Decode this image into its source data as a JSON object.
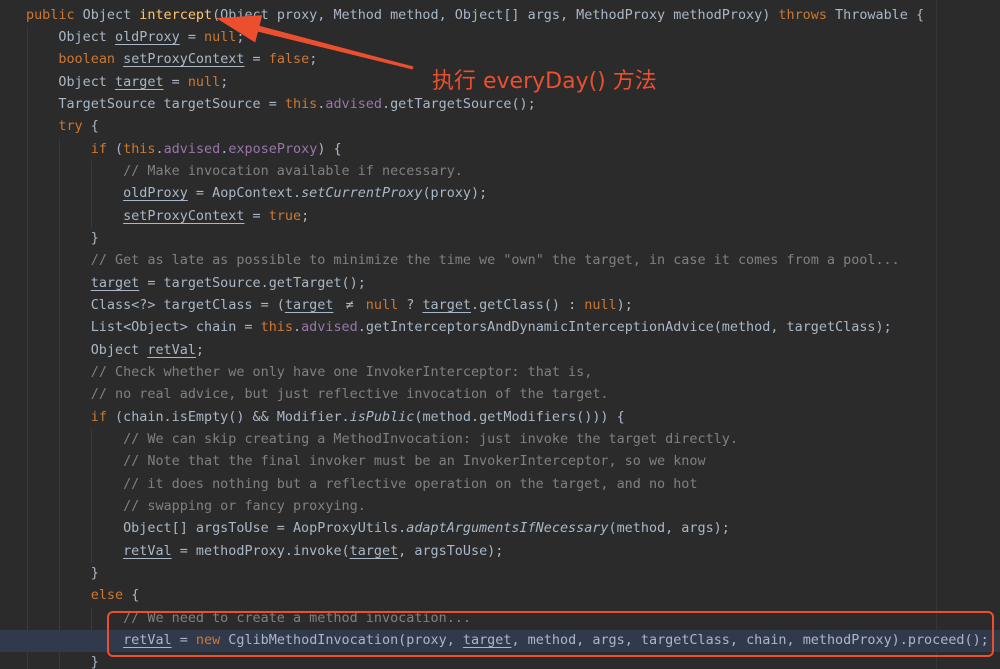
{
  "theme": {
    "background": "#2b2b2b",
    "text": "#a9b7c6",
    "keyword": "#cc7832",
    "method_declaration": "#ffc66d",
    "field": "#9876aa",
    "comment": "#808080",
    "caret_row": "#313a4b",
    "indent_guide": "#3a3a3a",
    "annotation": "#ec4f2e"
  },
  "editor": {
    "lines": [
      {
        "tokens": [
          {
            "t": "public",
            "k": "kw"
          },
          {
            "t": " Object "
          },
          {
            "t": "intercept",
            "k": "decl"
          },
          {
            "t": "(Object proxy, Method method, Object[] args, MethodProxy methodProxy) "
          },
          {
            "t": "throws",
            "k": "kw"
          },
          {
            "t": " Throwable {"
          }
        ]
      },
      {
        "tokens": [
          {
            "t": "    Object "
          },
          {
            "t": "oldProxy",
            "k": "var"
          },
          {
            "t": " = "
          },
          {
            "t": "null",
            "k": "kw"
          },
          {
            "t": ";"
          }
        ]
      },
      {
        "tokens": [
          {
            "t": "    "
          },
          {
            "t": "boolean",
            "k": "kw"
          },
          {
            "t": " "
          },
          {
            "t": "setProxyContext",
            "k": "var"
          },
          {
            "t": " = "
          },
          {
            "t": "false",
            "k": "kw"
          },
          {
            "t": ";"
          }
        ]
      },
      {
        "tokens": [
          {
            "t": "    Object "
          },
          {
            "t": "target",
            "k": "var"
          },
          {
            "t": " = "
          },
          {
            "t": "null",
            "k": "kw"
          },
          {
            "t": ";"
          }
        ]
      },
      {
        "tokens": [
          {
            "t": "    TargetSource targetSource = "
          },
          {
            "t": "this",
            "k": "kw"
          },
          {
            "t": "."
          },
          {
            "t": "advised",
            "k": "field"
          },
          {
            "t": ".getTargetSource();"
          }
        ]
      },
      {
        "tokens": [
          {
            "t": "    "
          },
          {
            "t": "try",
            "k": "kw"
          },
          {
            "t": " {"
          }
        ]
      },
      {
        "tokens": [
          {
            "t": "        "
          },
          {
            "t": "if",
            "k": "kw"
          },
          {
            "t": " ("
          },
          {
            "t": "this",
            "k": "kw"
          },
          {
            "t": "."
          },
          {
            "t": "advised",
            "k": "field"
          },
          {
            "t": "."
          },
          {
            "t": "exposeProxy",
            "k": "field"
          },
          {
            "t": ") {"
          }
        ]
      },
      {
        "tokens": [
          {
            "t": "            "
          },
          {
            "t": "// Make invocation available if necessary.",
            "k": "comment"
          }
        ]
      },
      {
        "tokens": [
          {
            "t": "            "
          },
          {
            "t": "oldProxy",
            "k": "var"
          },
          {
            "t": " = AopContext."
          },
          {
            "t": "setCurrentProxy",
            "k": "static"
          },
          {
            "t": "(proxy);"
          }
        ]
      },
      {
        "tokens": [
          {
            "t": "            "
          },
          {
            "t": "setProxyContext",
            "k": "var"
          },
          {
            "t": " = "
          },
          {
            "t": "true",
            "k": "kw"
          },
          {
            "t": ";"
          }
        ]
      },
      {
        "tokens": [
          {
            "t": "        }"
          }
        ]
      },
      {
        "tokens": [
          {
            "t": "        "
          },
          {
            "t": "// Get as late as possible to minimize the time we \"own\" the target, in case it comes from a pool...",
            "k": "comment"
          }
        ]
      },
      {
        "tokens": [
          {
            "t": "        "
          },
          {
            "t": "target",
            "k": "var"
          },
          {
            "t": " = targetSource.getTarget();"
          }
        ]
      },
      {
        "tokens": [
          {
            "t": "        Class<?> targetClass = ("
          },
          {
            "t": "target",
            "k": "var"
          },
          {
            "t": " "
          },
          {
            "t": "≠",
            "k": "lig"
          },
          {
            "t": " "
          },
          {
            "t": "null",
            "k": "kw"
          },
          {
            "t": " ? "
          },
          {
            "t": "target",
            "k": "var"
          },
          {
            "t": ".getClass() : "
          },
          {
            "t": "null",
            "k": "kw"
          },
          {
            "t": ");"
          }
        ]
      },
      {
        "tokens": [
          {
            "t": "        List<Object> chain = "
          },
          {
            "t": "this",
            "k": "kw"
          },
          {
            "t": "."
          },
          {
            "t": "advised",
            "k": "field"
          },
          {
            "t": ".getInterceptorsAndDynamicInterceptionAdvice(method, targetClass);"
          }
        ]
      },
      {
        "tokens": [
          {
            "t": "        Object "
          },
          {
            "t": "retVal",
            "k": "var"
          },
          {
            "t": ";"
          }
        ]
      },
      {
        "tokens": [
          {
            "t": "        "
          },
          {
            "t": "// Check whether we only have one InvokerInterceptor: that is,",
            "k": "comment"
          }
        ]
      },
      {
        "tokens": [
          {
            "t": "        "
          },
          {
            "t": "// no real advice, but just reflective invocation of the target.",
            "k": "comment"
          }
        ]
      },
      {
        "tokens": [
          {
            "t": "        "
          },
          {
            "t": "if",
            "k": "kw"
          },
          {
            "t": " (chain.isEmpty() && Modifier."
          },
          {
            "t": "isPublic",
            "k": "static"
          },
          {
            "t": "(method.getModifiers())) {"
          }
        ]
      },
      {
        "tokens": [
          {
            "t": "            "
          },
          {
            "t": "// We can skip creating a MethodInvocation: just invoke the target directly.",
            "k": "comment"
          }
        ]
      },
      {
        "tokens": [
          {
            "t": "            "
          },
          {
            "t": "// Note that the final invoker must be an InvokerInterceptor, so we know",
            "k": "comment"
          }
        ]
      },
      {
        "tokens": [
          {
            "t": "            "
          },
          {
            "t": "// it does nothing but a reflective operation on the target, and no hot",
            "k": "comment"
          }
        ]
      },
      {
        "tokens": [
          {
            "t": "            "
          },
          {
            "t": "// swapping or fancy proxying.",
            "k": "comment"
          }
        ]
      },
      {
        "tokens": [
          {
            "t": "            Object[] argsToUse = AopProxyUtils."
          },
          {
            "t": "adaptArgumentsIfNecessary",
            "k": "static"
          },
          {
            "t": "(method, args);"
          }
        ]
      },
      {
        "tokens": [
          {
            "t": "            "
          },
          {
            "t": "retVal",
            "k": "var"
          },
          {
            "t": " = methodProxy.invoke("
          },
          {
            "t": "target",
            "k": "var"
          },
          {
            "t": ", argsToUse);"
          }
        ]
      },
      {
        "tokens": [
          {
            "t": "        }"
          }
        ]
      },
      {
        "tokens": [
          {
            "t": "        "
          },
          {
            "t": "else",
            "k": "kw"
          },
          {
            "t": " {"
          }
        ]
      },
      {
        "tokens": [
          {
            "t": "            "
          },
          {
            "t": "// We need to create a method invocation...",
            "k": "comment"
          }
        ]
      },
      {
        "current": true,
        "tokens": [
          {
            "t": "            "
          },
          {
            "t": "retVal",
            "k": "var"
          },
          {
            "t": " = "
          },
          {
            "t": "new",
            "k": "kw"
          },
          {
            "t": " CglibMethodInvocation(proxy, "
          },
          {
            "t": "target",
            "k": "var"
          },
          {
            "t": ", method, args, targetClass, chain, methodProxy).proceed();"
          }
        ]
      },
      {
        "tokens": [
          {
            "t": "        }"
          }
        ]
      }
    ]
  },
  "annotations": {
    "arrow_label": "执行 everyDay() 方法"
  }
}
